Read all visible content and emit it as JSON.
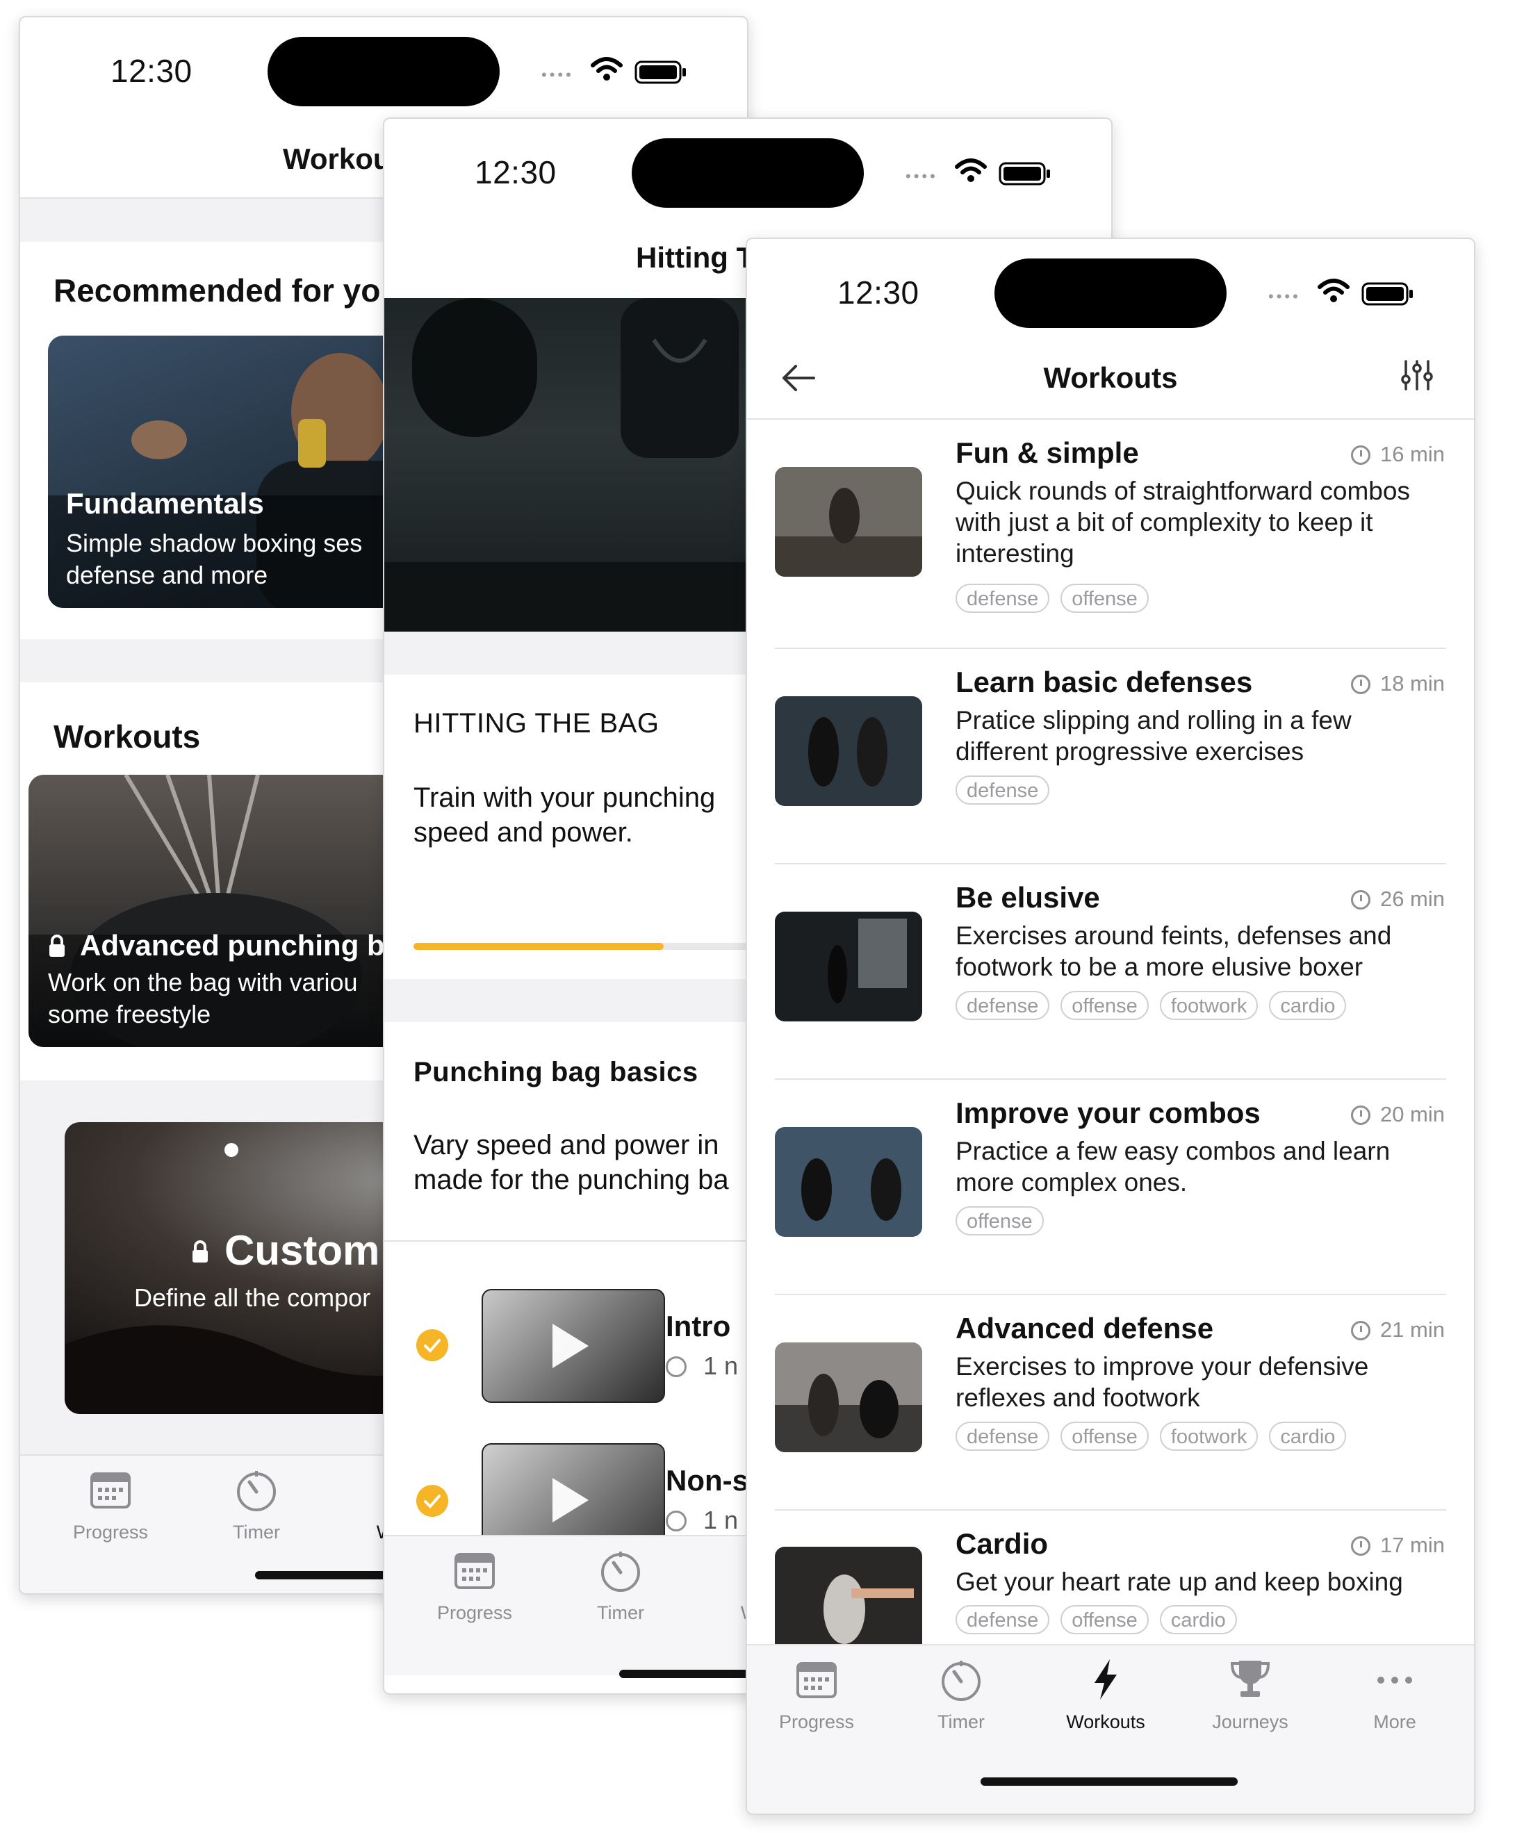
{
  "status": {
    "time": "12:30"
  },
  "tabs": [
    {
      "label": "Progress",
      "icon": "calendar-icon"
    },
    {
      "label": "Timer",
      "icon": "timer-icon"
    },
    {
      "label": "Workouts",
      "icon": "bolt-icon"
    },
    {
      "label": "Journeys",
      "icon": "trophy-icon"
    },
    {
      "label": "More",
      "icon": "more-icon"
    }
  ],
  "phone_a": {
    "nav_title": "Workou",
    "recommended_heading": "Recommended for yo",
    "fundamentals": {
      "title": "Fundamentals",
      "subtitle_line1": "Simple shadow boxing ses",
      "subtitle_line2": "defense and more"
    },
    "workouts_heading": "Workouts",
    "advanced_punching": {
      "title": "Advanced punching b",
      "subtitle_line1": "Work on the bag with variou",
      "subtitle_line2": "some freestyle"
    },
    "custom": {
      "title": "Custom",
      "subtitle": "Define all the compor"
    },
    "tab_partial_label": "Work"
  },
  "phone_b": {
    "nav_title": "Hitting T",
    "heading": "HITTING THE BAG",
    "desc_line1": "Train with your punching",
    "desc_line2": "speed and power.",
    "progress": 0.36,
    "section_title": "Punching bag basics",
    "section_line1": "Vary speed and power in",
    "section_line2": "made for the punching ba",
    "steps": [
      {
        "title": "Intro",
        "meta": "1 n"
      },
      {
        "title": "Non-s",
        "meta": "1 n"
      }
    ],
    "tab_partial_label": "Work"
  },
  "phone_c": {
    "nav_title": "Workouts",
    "workouts": [
      {
        "title": "Fun & simple",
        "duration": "16 min",
        "desc": [
          "Quick rounds of straightforward combos",
          "with just a bit of complexity to keep it",
          "interesting"
        ],
        "tags": [
          "defense",
          "offense"
        ]
      },
      {
        "title": "Learn basic defenses",
        "duration": "18 min",
        "desc": [
          "Pratice slipping and rolling in a few",
          "different progressive exercises"
        ],
        "tags": [
          "defense"
        ]
      },
      {
        "title": "Be elusive",
        "duration": "26 min",
        "desc": [
          "Exercises around feints, defenses and",
          "footwork to be a more elusive boxer"
        ],
        "tags": [
          "defense",
          "offense",
          "footwork",
          "cardio"
        ]
      },
      {
        "title": "Improve your combos",
        "duration": "20 min",
        "desc": [
          "Practice a few easy combos and learn",
          "more complex ones."
        ],
        "tags": [
          "offense"
        ]
      },
      {
        "title": "Advanced defense",
        "duration": "21 min",
        "desc": [
          "Exercises to improve your defensive",
          "reflexes and footwork"
        ],
        "tags": [
          "defense",
          "offense",
          "footwork",
          "cardio"
        ]
      },
      {
        "title": "Cardio",
        "duration": "17 min",
        "desc": [
          "Get your heart rate up and keep boxing"
        ],
        "tags": [
          "defense",
          "offense",
          "cardio"
        ]
      }
    ]
  },
  "colors": {
    "accent": "#f5b526",
    "tab_inactive": "#8c8c91",
    "separator": "#e3e3e6"
  }
}
